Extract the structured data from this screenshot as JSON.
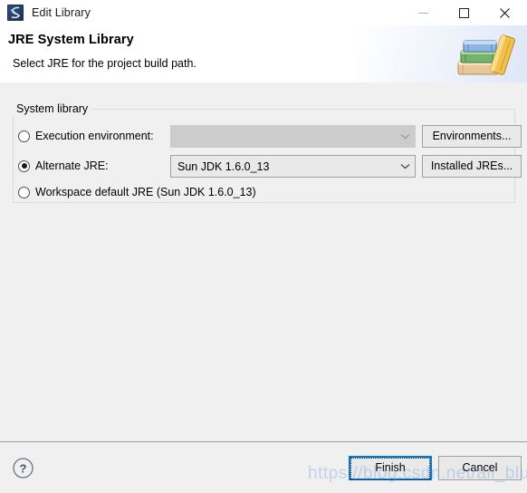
{
  "window": {
    "title": "Edit Library",
    "icon": "eclipse-library-icon",
    "controls": {
      "minimize": "minimize-icon",
      "maximize": "maximize-icon",
      "close": "close-icon"
    }
  },
  "header": {
    "title": "JRE System Library",
    "subtitle": "Select JRE for the project build path.",
    "banner_icon": "books-stack-icon"
  },
  "group": {
    "legend": "System library",
    "options": [
      {
        "id": "execution-environment",
        "label": "Execution environment:",
        "selected": false,
        "combo": {
          "value": "",
          "enabled": false
        },
        "button": "Environments..."
      },
      {
        "id": "alternate-jre",
        "label": "Alternate JRE:",
        "selected": true,
        "combo": {
          "value": "Sun JDK 1.6.0_13",
          "enabled": true
        },
        "button": "Installed JREs..."
      },
      {
        "id": "workspace-default-jre",
        "label": "Workspace default JRE (Sun JDK 1.6.0_13)",
        "selected": false
      }
    ]
  },
  "footer": {
    "help_icon": "help-question-icon",
    "finish_label": "Finish",
    "cancel_label": "Cancel"
  },
  "watermark": {
    "text": "https://blog.csdn.net/ail_blue"
  },
  "colors": {
    "accent": "#0078d7",
    "dialog_background": "#f0f0f0",
    "header_background": "#ffffff",
    "disabled_field": "#cccccc",
    "field": "#e9e9e9",
    "border": "#a0a0a0"
  }
}
